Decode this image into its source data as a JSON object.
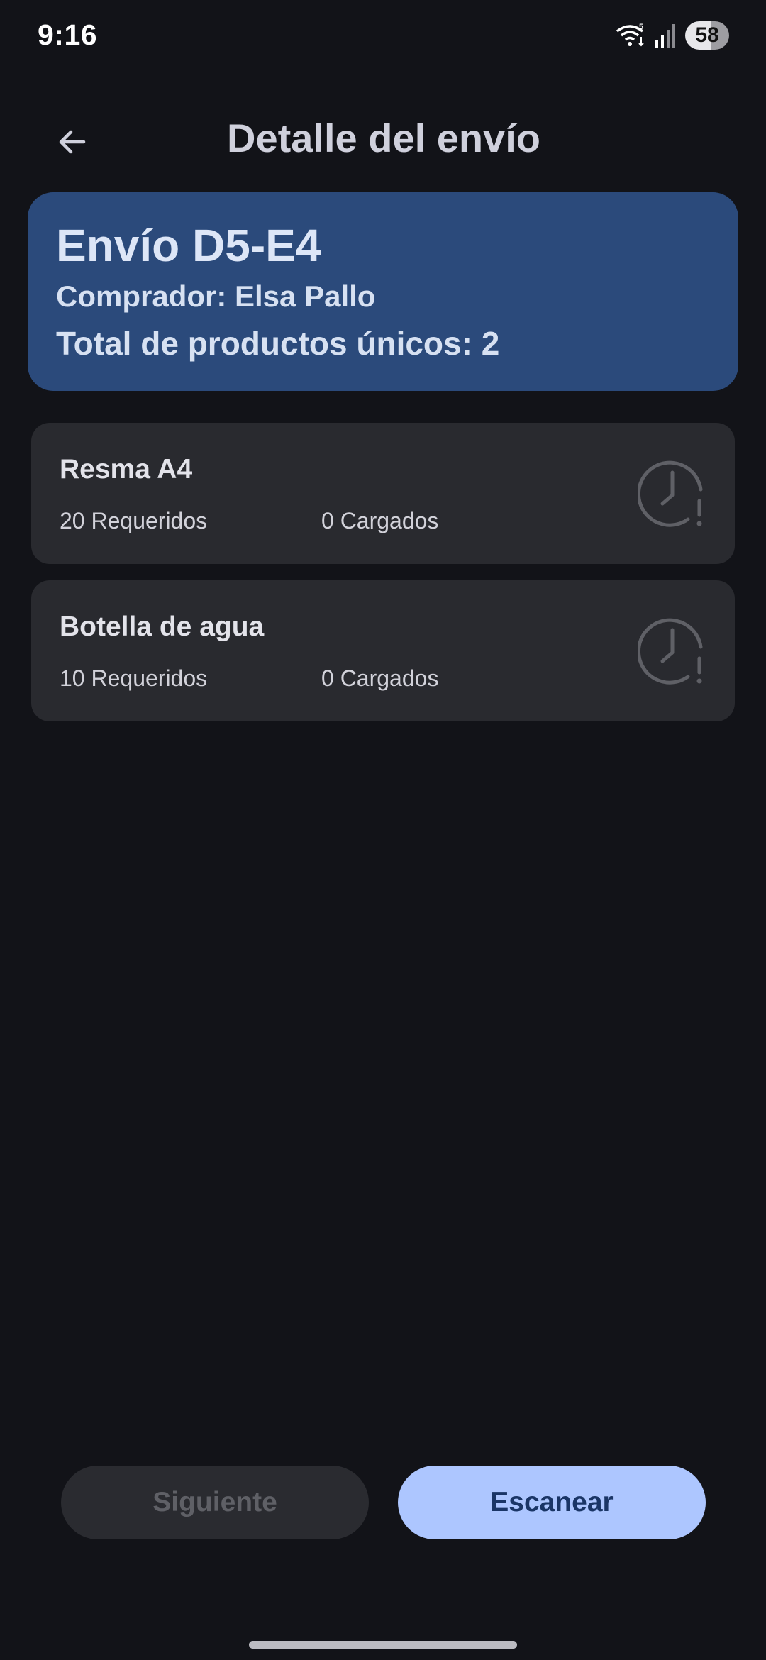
{
  "status_bar": {
    "time": "9:16",
    "battery": "58",
    "icons": [
      "wifi-icon",
      "signal-icon",
      "battery-icon"
    ]
  },
  "app_bar": {
    "back_icon": "arrow-back-icon",
    "title": "Detalle del envío"
  },
  "shipment": {
    "title": "Envío D5-E4",
    "buyer": "Comprador: Elsa Pallo",
    "total_unique": "Total de productos únicos: 2"
  },
  "products": [
    {
      "name": "Resma A4",
      "required": "20 Requeridos",
      "loaded": "0 Cargados",
      "status_icon": "clock-alert-icon"
    },
    {
      "name": "Botella de agua",
      "required": "10 Requeridos",
      "loaded": "0 Cargados",
      "status_icon": "clock-alert-icon"
    }
  ],
  "actions": {
    "next_label": "Siguiente",
    "scan_label": "Escanear"
  },
  "colors": {
    "background": "#121318",
    "header_card": "#2b4a7b",
    "product_card": "#292a2f",
    "primary_button": "#adc6ff",
    "disabled_button": "#2a2b30"
  }
}
